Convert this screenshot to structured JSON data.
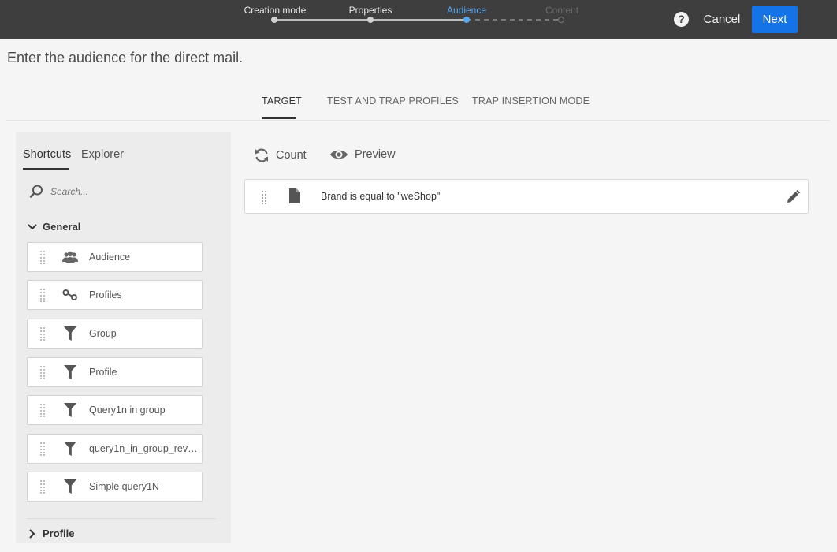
{
  "wizard": {
    "steps": [
      {
        "label": "Creation mode",
        "state": "done"
      },
      {
        "label": "Properties",
        "state": "done"
      },
      {
        "label": "Audience",
        "state": "active"
      },
      {
        "label": "Content",
        "state": "future"
      }
    ],
    "help_icon": "question-mark-icon",
    "cancel_label": "Cancel",
    "next_label": "Next",
    "colors": {
      "bar": "#3e3e3e",
      "accent": "#1473e6",
      "active_step": "#59a5f0"
    }
  },
  "page": {
    "title": "Enter the audience for the direct mail."
  },
  "tabs": [
    {
      "label": "TARGET",
      "active": true
    },
    {
      "label": "TEST AND TRAP PROFILES",
      "active": false
    },
    {
      "label": "TRAP INSERTION MODE",
      "active": false
    }
  ],
  "palette": {
    "tabs": [
      {
        "label": "Shortcuts",
        "active": true
      },
      {
        "label": "Explorer",
        "active": false
      }
    ],
    "search_placeholder": "Search...",
    "group": {
      "label": "General",
      "items": [
        {
          "label": "Audience",
          "icon": "users-icon"
        },
        {
          "label": "Profiles",
          "icon": "link-icon"
        },
        {
          "label": "Group",
          "icon": "filter-icon"
        },
        {
          "label": "Profile",
          "icon": "filter-icon"
        },
        {
          "label": "Query1n in group",
          "icon": "filter-icon"
        },
        {
          "label": "query1n_in_group_reve...",
          "icon": "filter-icon"
        },
        {
          "label": "Simple query1N",
          "icon": "filter-icon"
        }
      ]
    },
    "collapsed_group": {
      "label": "Profile"
    }
  },
  "actions": {
    "count_label": "Count",
    "preview_label": "Preview"
  },
  "rule": {
    "text": "Brand is equal to \"weShop\"",
    "icon": "document-icon"
  }
}
